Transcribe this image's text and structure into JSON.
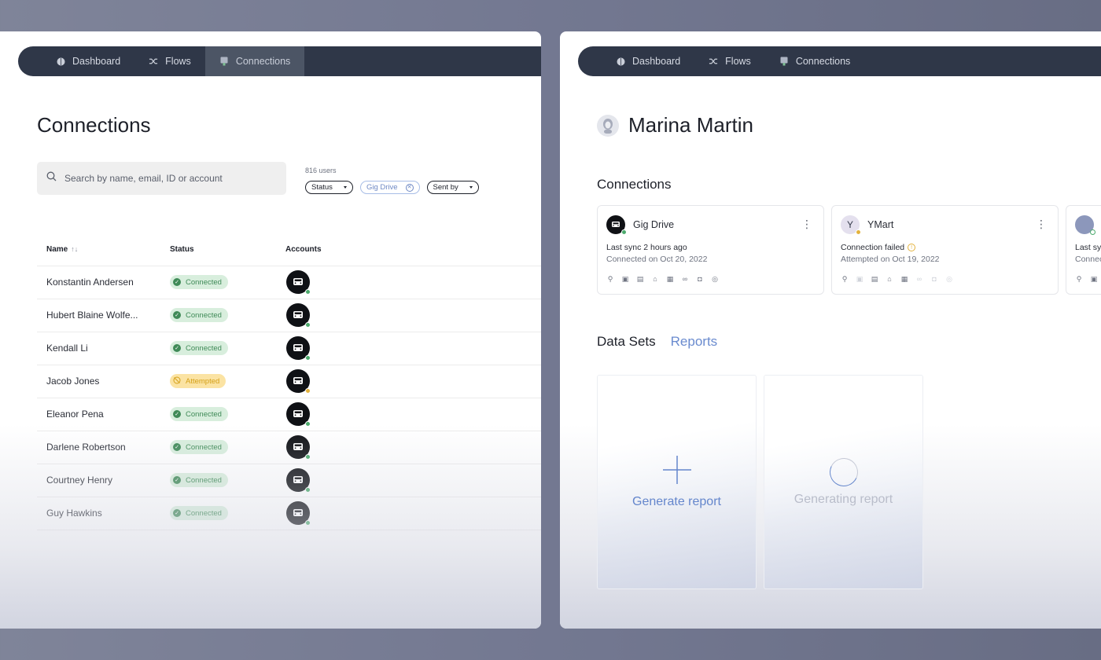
{
  "nav": {
    "items": [
      {
        "label": "Dashboard",
        "icon": "brain-icon"
      },
      {
        "label": "Flows",
        "icon": "shuffle-icon"
      },
      {
        "label": "Connections",
        "icon": "plug-icon"
      }
    ],
    "left_active": "Connections"
  },
  "connections_page": {
    "title": "Connections",
    "search": {
      "placeholder": "Search by name, email, ID or account",
      "value": ""
    },
    "user_count": "816 users",
    "filters": {
      "status": "Status",
      "applied": "Gig Drive",
      "sent_by": "Sent by"
    },
    "columns": {
      "name": "Name",
      "status": "Status",
      "accounts": "Accounts"
    },
    "rows": [
      {
        "name": "Konstantin Andersen",
        "status": "Connected",
        "status_kind": "connected",
        "account_status": "green"
      },
      {
        "name": "Hubert Blaine Wolfe...",
        "status": "Connected",
        "status_kind": "connected",
        "account_status": "green"
      },
      {
        "name": "Kendall Li",
        "status": "Connected",
        "status_kind": "connected",
        "account_status": "green"
      },
      {
        "name": "Jacob Jones",
        "status": "Attempted",
        "status_kind": "attempted",
        "account_status": "yellow"
      },
      {
        "name": "Eleanor Pena",
        "status": "Connected",
        "status_kind": "connected",
        "account_status": "green"
      },
      {
        "name": "Darlene Robertson",
        "status": "Connected",
        "status_kind": "connected",
        "account_status": "green"
      },
      {
        "name": "Courtney Henry",
        "status": "Connected",
        "status_kind": "connected",
        "account_status": "green"
      },
      {
        "name": "Guy Hawkins",
        "status": "Connected",
        "status_kind": "connected",
        "account_status": "green"
      }
    ]
  },
  "user_page": {
    "name": "Marina Martin",
    "connections_title": "Connections",
    "cards": [
      {
        "name": "Gig Drive",
        "line1": "Last sync 2 hours ago",
        "line2": "Connected on Oct 20, 2022",
        "warning": false
      },
      {
        "name": "YMart",
        "line1": "Connection failed",
        "line2": "Attempted on Oct 19, 2022",
        "warning": true
      },
      {
        "name": "",
        "line1": "Last sync",
        "line2": "Connected",
        "warning": false
      }
    ],
    "tabs": {
      "data_sets": "Data Sets",
      "reports": "Reports",
      "active": "Reports"
    },
    "tiles": {
      "generate": "Generate report",
      "generating": "Generating report"
    }
  },
  "colors": {
    "nav_bg": "#2f3748",
    "accent_blue": "#6486cc",
    "connected_green": "#3f8a57",
    "attempted_yellow": "#e3b23c"
  }
}
